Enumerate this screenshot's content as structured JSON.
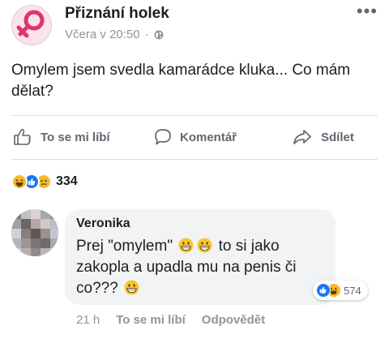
{
  "post": {
    "page_name": "Přiznání holek",
    "timestamp": "Včera v 20:50",
    "separator": "·",
    "privacy_icon": "globe-icon",
    "more_icon": "ellipsis-icon",
    "text": "Omylem jsem svedla kamarádce kluka... Co mám dělat?"
  },
  "actions": {
    "like_label": "To se mi líbí",
    "comment_label": "Komentář",
    "share_label": "Sdílet"
  },
  "reactions": {
    "icons": [
      "haha-icon",
      "like-icon",
      "sad-icon"
    ],
    "count": "334"
  },
  "comment": {
    "author": "Veronika",
    "text_parts": [
      "Prej \"omylem\"",
      " to si jako zakopla a upadla mu na penis či co???"
    ],
    "reactions_icons": [
      "like-icon",
      "haha-icon"
    ],
    "reactions_count": "574",
    "time": "21 h",
    "like_label": "To se mi líbí",
    "reply_label": "Odpovědět"
  },
  "colors": {
    "text": "#1c1e21",
    "secondary": "#606770",
    "meta": "#8d949e",
    "like_blue": "#1877f2",
    "bubble": "#f2f3f5",
    "logo_pink": "#e0336f"
  }
}
